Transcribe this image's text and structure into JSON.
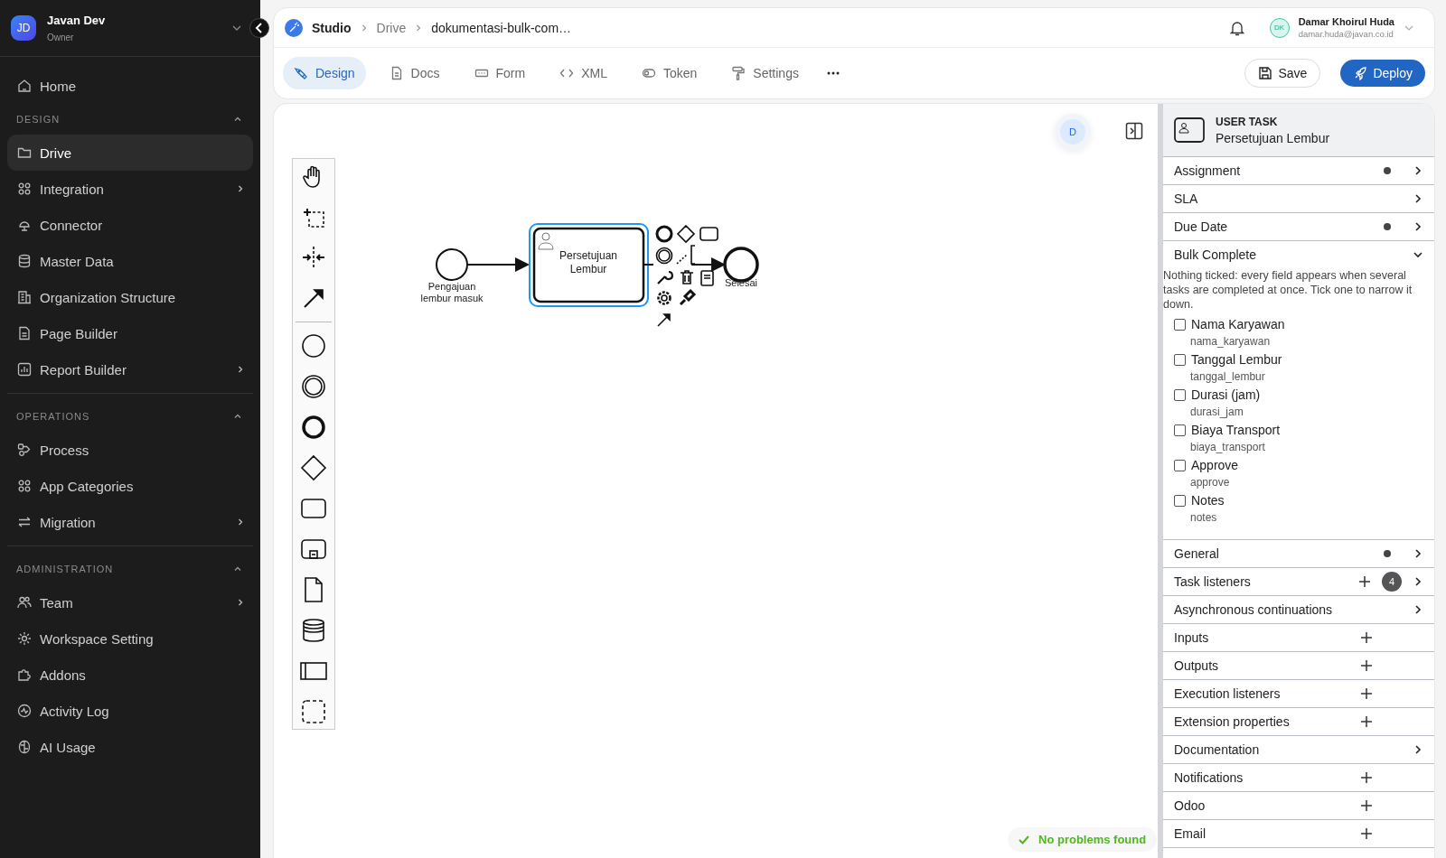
{
  "workspace": {
    "initials": "JD",
    "name": "Javan Dev",
    "role": "Owner"
  },
  "sidebar": {
    "top_items": [
      {
        "label": "Home",
        "selected": false
      }
    ],
    "sections": [
      {
        "title": "DESIGN",
        "expanded": true,
        "items": [
          {
            "label": "Drive",
            "selected": true,
            "has_submenu": false
          },
          {
            "label": "Integration",
            "selected": false,
            "has_submenu": true
          },
          {
            "label": "Connector",
            "selected": false,
            "has_submenu": false
          },
          {
            "label": "Master Data",
            "selected": false,
            "has_submenu": false
          },
          {
            "label": "Organization Structure",
            "selected": false,
            "has_submenu": false
          },
          {
            "label": "Page Builder",
            "selected": false,
            "has_submenu": false
          },
          {
            "label": "Report Builder",
            "selected": false,
            "has_submenu": true
          }
        ]
      },
      {
        "title": "OPERATIONS",
        "expanded": true,
        "items": [
          {
            "label": "Process",
            "selected": false,
            "has_submenu": false
          },
          {
            "label": "App Categories",
            "selected": false,
            "has_submenu": false
          },
          {
            "label": "Migration",
            "selected": false,
            "has_submenu": true
          }
        ]
      },
      {
        "title": "ADMINISTRATION",
        "expanded": true,
        "items": [
          {
            "label": "Team",
            "selected": false,
            "has_submenu": true
          },
          {
            "label": "Workspace Setting",
            "selected": false,
            "has_submenu": false
          },
          {
            "label": "Addons",
            "selected": false,
            "has_submenu": false
          },
          {
            "label": "Activity Log",
            "selected": false,
            "has_submenu": false
          },
          {
            "label": "AI Usage",
            "selected": false,
            "has_submenu": false
          }
        ]
      }
    ]
  },
  "header": {
    "breadcrumb": [
      "Studio",
      "Drive",
      "dokumentasi-bulk-com…"
    ],
    "user": {
      "initials": "DK",
      "name": "Damar Khoirul Huda",
      "email": "damar.huda@javan.co.id"
    }
  },
  "tabs": [
    {
      "label": "Design",
      "selected": true
    },
    {
      "label": "Docs",
      "selected": false
    },
    {
      "label": "Form",
      "selected": false
    },
    {
      "label": "XML",
      "selected": false
    },
    {
      "label": "Token",
      "selected": false
    },
    {
      "label": "Settings",
      "selected": false
    }
  ],
  "actions": {
    "save": "Save",
    "deploy": "Deploy"
  },
  "canvas": {
    "collaborator": "D",
    "palette": [
      {
        "kind": "hand"
      },
      {
        "kind": "lasso"
      },
      {
        "kind": "space"
      },
      {
        "kind": "connect"
      },
      {
        "kind": "divider"
      },
      {
        "kind": "start"
      },
      {
        "kind": "intermediate"
      },
      {
        "kind": "end"
      },
      {
        "kind": "gateway"
      },
      {
        "kind": "task"
      },
      {
        "kind": "subprocess"
      },
      {
        "kind": "data-object"
      },
      {
        "kind": "data-store"
      },
      {
        "kind": "pool"
      },
      {
        "kind": "group"
      }
    ],
    "diagram": {
      "start_event": {
        "label": [
          "Pengajuan",
          "lembur masuk"
        ]
      },
      "user_task": {
        "label": [
          "Persetujuan",
          "Lembur"
        ],
        "selected": true
      },
      "end_event": {
        "label": [
          "Selesai"
        ]
      }
    },
    "status": "No problems found"
  },
  "properties": {
    "element_type": "USER TASK",
    "element_name": "Persetujuan Lembur",
    "sections": [
      {
        "title": "Assignment",
        "dot": true,
        "add": false,
        "expanded": false
      },
      {
        "title": "SLA",
        "dot": false,
        "add": false,
        "expanded": false
      },
      {
        "title": "Due Date",
        "dot": true,
        "add": false,
        "expanded": false
      },
      {
        "title": "Bulk Complete",
        "dot": false,
        "add": false,
        "expanded": true,
        "description": "Nothing ticked: every field appears when several tasks are completed at once. Tick one to narrow it down.",
        "fields": [
          {
            "label": "Nama Karyawan",
            "key": "nama_karyawan",
            "checked": false
          },
          {
            "label": "Tanggal Lembur",
            "key": "tanggal_lembur",
            "checked": false
          },
          {
            "label": "Durasi (jam)",
            "key": "durasi_jam",
            "checked": false
          },
          {
            "label": "Biaya Transport",
            "key": "biaya_transport",
            "checked": false
          },
          {
            "label": "Approve",
            "key": "approve",
            "checked": false
          },
          {
            "label": "Notes",
            "key": "notes",
            "checked": false
          }
        ]
      },
      {
        "title": "General",
        "dot": true,
        "add": false,
        "expanded": false
      },
      {
        "title": "Task listeners",
        "dot": false,
        "add": true,
        "count": "4",
        "expanded": false
      },
      {
        "title": "Asynchronous continuations",
        "dot": false,
        "add": false,
        "expanded": false
      },
      {
        "title": "Inputs",
        "dot": false,
        "add": true
      },
      {
        "title": "Outputs",
        "dot": false,
        "add": true
      },
      {
        "title": "Execution listeners",
        "dot": false,
        "add": true
      },
      {
        "title": "Extension properties",
        "dot": false,
        "add": true
      },
      {
        "title": "Documentation",
        "dot": false,
        "add": false,
        "expanded": false
      },
      {
        "title": "Notifications",
        "dot": false,
        "add": true
      },
      {
        "title": "Odoo",
        "dot": false,
        "add": true
      },
      {
        "title": "Email",
        "dot": false,
        "add": true
      }
    ]
  }
}
